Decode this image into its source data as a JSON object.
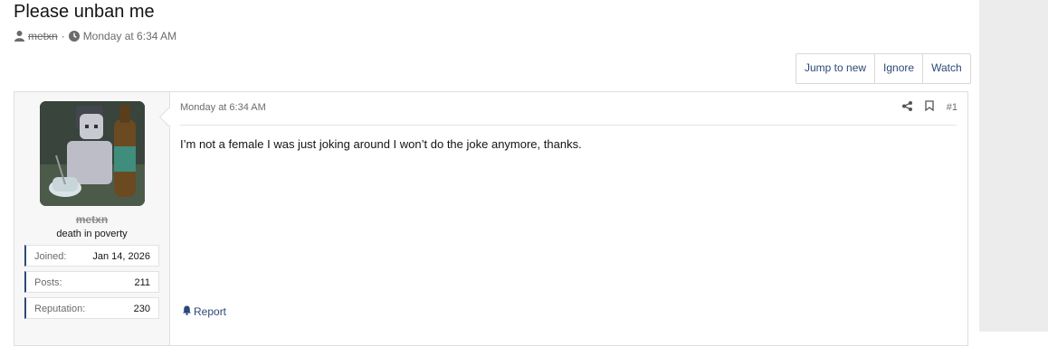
{
  "thread": {
    "title": "Please unban me",
    "author": "metxn",
    "separator": "·",
    "date": "Monday at 6:34 AM"
  },
  "actions": {
    "jump_to_new": "Jump to new",
    "ignore": "Ignore",
    "watch": "Watch"
  },
  "post": {
    "date": "Monday at 6:34 AM",
    "number": "#1",
    "body": "I’m not a female I was just joking around I won’t do the joke anymore, thanks.",
    "report": "Report",
    "user": {
      "name": "metxn",
      "title": "death in poverty",
      "stats": [
        {
          "label": "Joined:",
          "value": "Jan 14, 2026"
        },
        {
          "label": "Posts:",
          "value": "211"
        },
        {
          "label": "Reputation:",
          "value": "230"
        }
      ]
    }
  },
  "colors": {
    "link": "#2b4a78",
    "muted": "#6b6b6b",
    "sidebar": "#ececec"
  }
}
